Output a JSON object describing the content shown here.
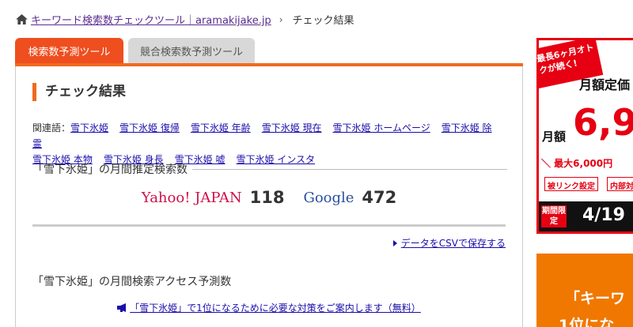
{
  "breadcrumb": {
    "home_link": "キーワード検索数チェックツール｜aramakijake.jp",
    "separator": "›",
    "current": "チェック結果"
  },
  "tabs": [
    {
      "label": "検索数予測ツール",
      "active": true
    },
    {
      "label": "競合検索数予測ツール",
      "active": false
    }
  ],
  "main": {
    "title": "チェック結果",
    "related_label": "関連語：",
    "related_keywords": [
      "雪下氷姫",
      "雪下氷姫 復帰",
      "雪下氷姫 年齢",
      "雪下氷姫 現在",
      "雪下氷姫 ホームページ",
      "雪下氷姫 除霊",
      "雪下氷姫 本物",
      "雪下氷姫 身長",
      "雪下氷姫 嘘",
      "雪下氷姫 インスタ"
    ],
    "monthly_search_title": "「雪下氷姫」の月間推定検索数",
    "engines": [
      {
        "name": "Yahoo! JAPAN",
        "count": "118"
      },
      {
        "name": "Google",
        "count": "472"
      }
    ],
    "csv_link": "データをCSVで保存する",
    "access_title": "「雪下氷姫」の月間検索アクセス予測数",
    "promo_text": "「雪下氷姫」で1位になるために必要な対策をご案内します（無料）"
  },
  "ads": {
    "ad1": {
      "ribbon": "最長6ヶ月オトクが続く!",
      "headline": "月額定価",
      "amount_prefix": "月額",
      "amount": "6,9",
      "discount": "＼ 最大6,000円",
      "tags": [
        "被リンク設定",
        "内部対"
      ],
      "limited": "期間限定",
      "date": "4/19"
    },
    "ad2": {
      "line1": "「キーワ",
      "line2": "1位にな"
    }
  },
  "colors": {
    "accent_orange": "#ef6a1f",
    "tab_active": "#ef4e1f",
    "yahoo_red": "#d0104c",
    "google_blue": "#2a4fa0",
    "link": "#1a0dab",
    "ad_red": "#e60012"
  }
}
